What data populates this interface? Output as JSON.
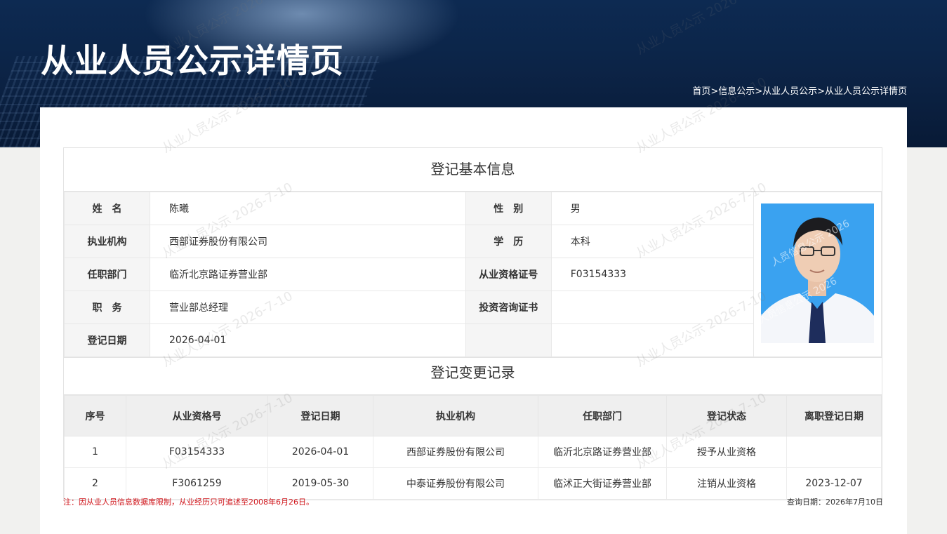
{
  "header": {
    "title": "从业人员公示详情页",
    "breadcrumb": "首页>信息公示>从业人员公示>从业人员公示详情页"
  },
  "basic": {
    "title": "登记基本信息",
    "rows": [
      {
        "l1": "姓　名",
        "v1": "陈曦",
        "l2": "性　别",
        "v2": "男"
      },
      {
        "l1": "执业机构",
        "v1": "西部证券股份有限公司",
        "l2": "学　历",
        "v2": "本科"
      },
      {
        "l1": "任职部门",
        "v1": "临沂北京路证券营业部",
        "l2": "从业资格证号",
        "v2": "F03154333"
      },
      {
        "l1": "职　务",
        "v1": "营业部总经理",
        "l2": "投资咨询证书",
        "v2": ""
      },
      {
        "l1": "登记日期",
        "v1": "2026-04-01",
        "l2": "",
        "v2": ""
      }
    ]
  },
  "changes": {
    "title": "登记变更记录",
    "headers": [
      "序号",
      "从业资格号",
      "登记日期",
      "执业机构",
      "任职部门",
      "登记状态",
      "离职登记日期"
    ],
    "rows": [
      [
        "1",
        "F03154333",
        "2026-04-01",
        "西部证券股份有限公司",
        "临沂北京路证券营业部",
        "授予从业资格",
        ""
      ],
      [
        "2",
        "F3061259",
        "2019-05-30",
        "中泰证券股份有限公司",
        "临沭正大街证券营业部",
        "注销从业资格",
        "2023-12-07"
      ]
    ]
  },
  "footer": {
    "note": "注：因从业人员信息数据库限制，从业经历只可追述至2008年6月26日。",
    "query_date": "查询日期：2026年7月10日"
  },
  "watermark": {
    "text": "从业人员公示 2026-7-10",
    "photo_text": "人员信息公示 2026"
  },
  "colors": {
    "banner": "#0c2447",
    "note": "#d0141a",
    "photo_bg": "#3aa2f0"
  }
}
